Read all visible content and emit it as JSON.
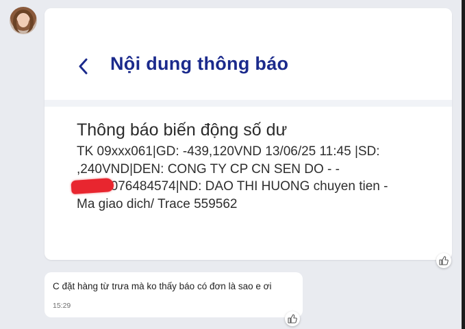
{
  "header": {
    "title": "Nội dung thông báo",
    "back_icon": "chevron-left-icon"
  },
  "notification": {
    "title": "Thông báo biến động số dư",
    "body": "TK 09xxx061|GD: -439,120VND 13/06/25 11:45 |SD:\n      ,240VND|DEN: CONG TY CP CN SEN DO - -\nSEN1076484574|ND: DAO THI HUONG chuyen tien -\nMa giao dich/ Trace 559562"
  },
  "reply": {
    "text": "C đặt hàng từ trưa mà ko thấy báo có đơn là sao e ơi",
    "time": "15:29"
  },
  "icons": {
    "like": "thumbs-up-icon",
    "avatar": "avatar"
  },
  "colors": {
    "title_blue": "#1b2a8c",
    "redaction": "#e8262f",
    "background": "#e9ebf0"
  }
}
